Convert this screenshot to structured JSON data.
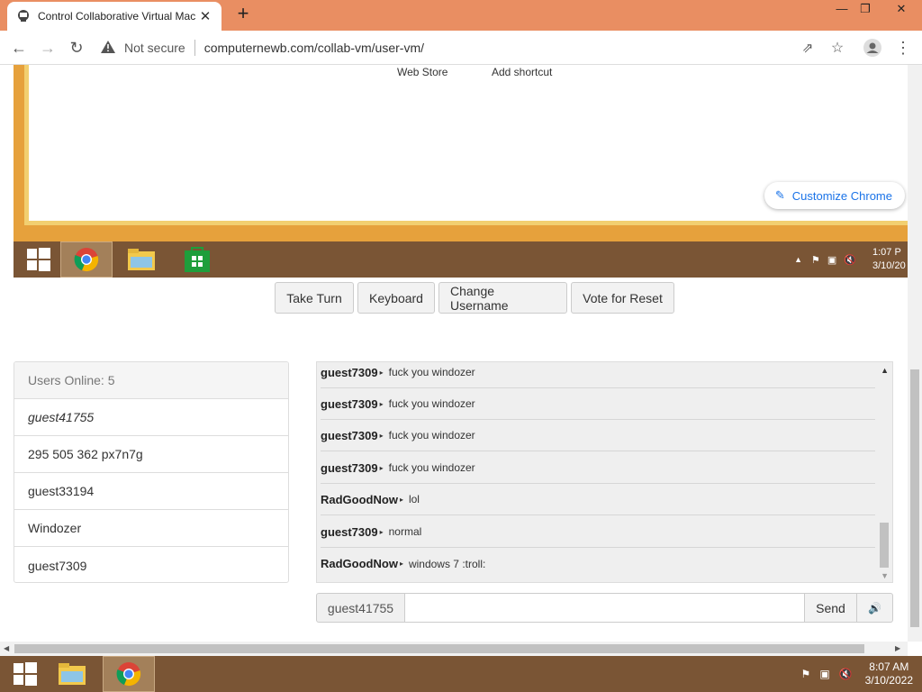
{
  "browser": {
    "tab_title": "Control Collaborative Virtual Mac",
    "security_label": "Not secure",
    "url": "computernewb.com/collab-vm/user-vm/"
  },
  "vm_screen": {
    "shortcuts": [
      "Web Store",
      "Add shortcut"
    ],
    "customize_label": "Customize Chrome",
    "clock_time": "1:07 P",
    "clock_date": "3/10/20"
  },
  "controls": {
    "take_turn": "Take Turn",
    "keyboard": "Keyboard",
    "change_username": "Change Username",
    "vote_reset": "Vote for Reset"
  },
  "users_panel": {
    "header": "Users Online: 5",
    "users": [
      "guest41755",
      "295 505 362 px7n7g",
      "guest33194",
      "Windozer",
      "guest7309"
    ]
  },
  "chat": {
    "messages": [
      {
        "user": "guest7309",
        "text": "fuck you windozer"
      },
      {
        "user": "guest7309",
        "text": "fuck you windozer"
      },
      {
        "user": "guest7309",
        "text": "fuck you windozer"
      },
      {
        "user": "guest7309",
        "text": "fuck you windozer"
      },
      {
        "user": "RadGoodNow",
        "text": "lol"
      },
      {
        "user": "guest7309",
        "text": "normal"
      },
      {
        "user": "RadGoodNow",
        "text": "windows 7 :troll:"
      }
    ],
    "username": "guest41755",
    "input_value": "",
    "send_label": "Send"
  },
  "host_taskbar": {
    "time": "8:07 AM",
    "date": "3/10/2022"
  },
  "colors": {
    "titlebar": "#e98e62",
    "taskbar": "#7a5535",
    "vm_desktop": "#e6a13c",
    "link_blue": "#1a73e8"
  }
}
